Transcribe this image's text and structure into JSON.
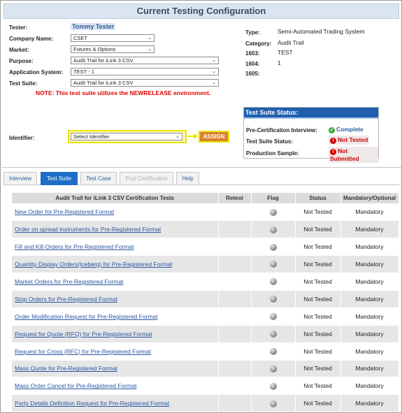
{
  "header": {
    "title": "Current Testing Configuration"
  },
  "form": {
    "tester_label": "Tester:",
    "tester_value": "Tommy Tester",
    "company_label": "Company Name:",
    "company_value": "CSET",
    "market_label": "Market:",
    "market_value": "Futures & Options",
    "purpose_label": "Purpose:",
    "purpose_value": "Audit Trail for iLink 3 CSV",
    "app_system_label": "Application System:",
    "app_system_value": "TEST - 1",
    "test_suite_label": "Test Suite:",
    "test_suite_value": "Audit Trail for iLink 3 CSV",
    "note": "NOTE: This test suite utilizes the NEWRELEASE environment.",
    "identifier_label": "Identifier:",
    "identifier_value": "Select Identifier",
    "assign_label": "ASSIGN"
  },
  "info": {
    "type_label": "Type:",
    "type_value": "Semi-Automated Trading System",
    "category_label": "Category:",
    "category_value": "Audit Trail",
    "f1603_label": "1603:",
    "f1603_value": "TEST",
    "f1604_label": "1604:",
    "f1604_value": "1",
    "f1605_label": "1605:",
    "f1605_value": ""
  },
  "status_box": {
    "title": "Test Suite Status:",
    "precert_label": "Pre-Certification Interview:",
    "precert_value": "Complete",
    "suite_label": "Test Suite Status:",
    "suite_value": "Not Tested",
    "production_label": "Production Sample:",
    "production_value": "Not Submitted"
  },
  "tabs": [
    {
      "label": "Interview"
    },
    {
      "label": "Test Suite"
    },
    {
      "label": "Test Case"
    },
    {
      "label": "Post Certification"
    },
    {
      "label": "Help"
    }
  ],
  "table": {
    "headers": [
      "Audit Trail for iLink 3 CSV Certification Tests",
      "Retest",
      "Flag",
      "Status",
      "Mandatory/Optional"
    ],
    "rows": [
      {
        "name": "New Order for Pre-Registered Format",
        "retest": "",
        "status": "Not Tested",
        "mandatory": "Mandatory"
      },
      {
        "name": "Order on spread instruments for Pre-Registered Format",
        "retest": "",
        "status": "Not Tested",
        "mandatory": "Mandatory"
      },
      {
        "name": "Fill and Kill Orders for Pre-Registered Format",
        "retest": "",
        "status": "Not Tested",
        "mandatory": "Mandatory"
      },
      {
        "name": "Quantity Display Orders(Iceberg) for Pre-Registered Format",
        "retest": "",
        "status": "Not Tested",
        "mandatory": "Mandatory"
      },
      {
        "name": "Market Orders for Pre-Registered Format",
        "retest": "",
        "status": "Not Tested",
        "mandatory": "Mandatory"
      },
      {
        "name": "Stop Orders for Pre-Registered Format",
        "retest": "",
        "status": "Not Tested",
        "mandatory": "Mandatory"
      },
      {
        "name": "Order Modification Request for Pre-Registered Format",
        "retest": "",
        "status": "Not Tested",
        "mandatory": "Mandatory"
      },
      {
        "name": "Request for Quote (RFQ) for Pre-Registered Format",
        "retest": "",
        "status": "Not Tested",
        "mandatory": "Mandatory"
      },
      {
        "name": "Request for Cross (RFC) for Pre-Registered Format",
        "retest": "",
        "status": "Not Tested",
        "mandatory": "Mandatory"
      },
      {
        "name": "Mass Quote for Pre-Registered Format",
        "retest": "",
        "status": "Not Tested",
        "mandatory": "Mandatory"
      },
      {
        "name": "Mass Order Cancel for Pre-Registered Format",
        "retest": "",
        "status": "Not Tested",
        "mandatory": "Mandatory"
      },
      {
        "name": "Party Details Definition Request for Pre-Registered Format",
        "retest": "",
        "status": "Not Tested",
        "mandatory": "Mandatory"
      }
    ]
  }
}
